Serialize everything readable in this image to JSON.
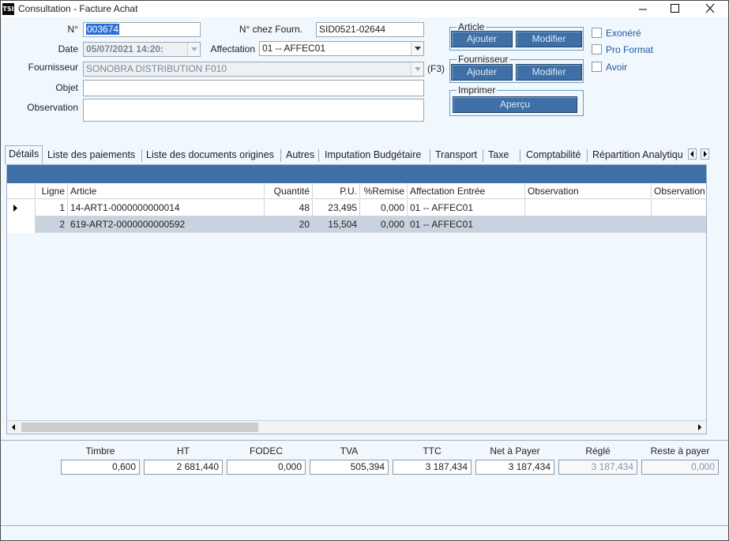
{
  "window": {
    "title": "Consultation - Facture Achat",
    "app_icon": "TSI"
  },
  "form": {
    "no_label": "N°",
    "no_value": "003674",
    "date_label": "Date",
    "date_value": "05/07/2021 14:20:",
    "supplier_no_label": "N° chez Fourn.",
    "supplier_no_value": "SID0521-02644",
    "affectation_label": "Affectation",
    "affectation_value": "01 -- AFFEC01",
    "fournisseur_label": "Fournisseur",
    "fournisseur_value": "SONOBRA DISTRIBUTION F010",
    "f3_hint": "(F3)",
    "objet_label": "Objet",
    "objet_value": "",
    "observation_label": "Observation",
    "observation_value": ""
  },
  "groups": {
    "article": {
      "title": "Article",
      "add": "Ajouter",
      "modify": "Modifier"
    },
    "fournisseur": {
      "title": "Fournisseur",
      "add": "Ajouter",
      "modify": "Modifier"
    },
    "imprimer": {
      "title": "Imprimer",
      "preview": "Aperçu"
    }
  },
  "checkboxes": [
    {
      "label": "Exonéré",
      "checked": false
    },
    {
      "label": "Pro Format",
      "checked": false
    },
    {
      "label": "Avoir",
      "checked": false
    }
  ],
  "tabs": [
    "Détails",
    "Liste des paiements",
    "Liste des documents origines",
    "Autres",
    "Imputation Budgétaire",
    "Transport",
    "Taxe",
    "Comptabilité",
    "Répartition Analytiqu"
  ],
  "grid": {
    "headers": [
      "Ligne",
      "Article",
      "Quantité",
      "P.U.",
      "%Remise",
      "Affectation Entrée",
      "Observation",
      "Observation"
    ],
    "rows": [
      {
        "ligne": "1",
        "article": "14-ART1-0000000000014",
        "quantite": "48",
        "pu": "23,495",
        "remise": "0,000",
        "affectation": "01 -- AFFEC01",
        "obs1": "",
        "obs2": ""
      },
      {
        "ligne": "2",
        "article": "619-ART2-0000000000592",
        "quantite": "20",
        "pu": "15,504",
        "remise": "0,000",
        "affectation": "01 -- AFFEC01",
        "obs1": "",
        "obs2": ""
      }
    ]
  },
  "totals": [
    {
      "label": "Timbre",
      "value": "0,600"
    },
    {
      "label": "HT",
      "value": "2 681,440"
    },
    {
      "label": "FODEC",
      "value": "0,000"
    },
    {
      "label": "TVA",
      "value": "505,394"
    },
    {
      "label": "TTC",
      "value": "3 187,434"
    },
    {
      "label": "Net à Payer",
      "value": "3 187,434"
    },
    {
      "label": "Réglé",
      "value": "3 187,434"
    },
    {
      "label": "Reste à payer",
      "value": "0,000"
    }
  ]
}
